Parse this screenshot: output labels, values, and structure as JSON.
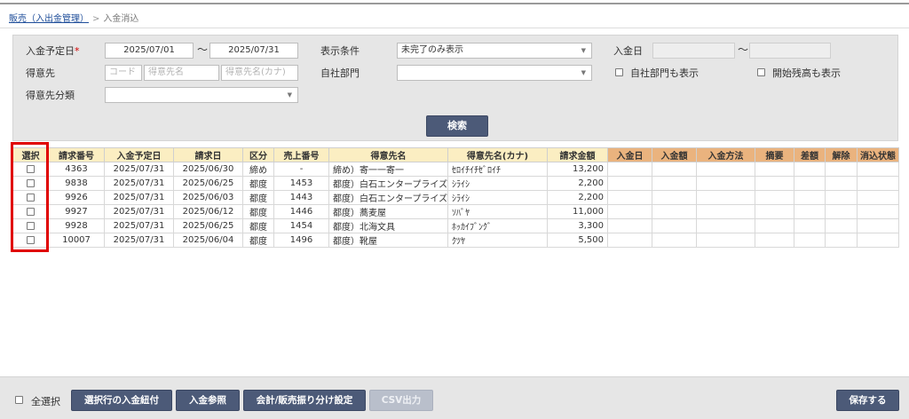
{
  "breadcrumb": {
    "parent": "販売（入出金管理）",
    "separator": ">",
    "current": "入金消込"
  },
  "search": {
    "due_date_label": "入金予定日",
    "required_mark": "*",
    "due_date_from": "2025/07/01",
    "range_sep": "〜",
    "due_date_to": "2025/07/31",
    "customer_label": "得意先",
    "customer_code_ph": "コード",
    "customer_name_ph": "得意先名",
    "customer_kana_ph": "得意先名(カナ)",
    "customer_class_label": "得意先分類",
    "customer_class_value": "",
    "display_label": "表示条件",
    "display_value": "未完了のみ表示",
    "dept_label": "自社部門",
    "dept_value": "",
    "payment_date_label": "入金日",
    "payment_date_from": "",
    "payment_date_to": "",
    "show_dept_label": "自社部門も表示",
    "show_opening_label": "開始残高も表示",
    "search_button": "検索"
  },
  "table": {
    "headers": [
      "選択",
      "請求番号",
      "入金予定日",
      "請求日",
      "区分",
      "売上番号",
      "得意先名",
      "得意先名(カナ)",
      "請求金額",
      "入金日",
      "入金額",
      "入金方法",
      "摘要",
      "差額",
      "解除",
      "消込状態"
    ],
    "rows": [
      {
        "invoice_no": "4363",
        "due_date": "2025/07/31",
        "invoice_date": "2025/06/30",
        "kind": "締め",
        "sales_no": "-",
        "customer": "締め）寄一一寄一",
        "kana": "ｾﾛｲﾁｲﾁｾﾞﾛｲﾁ",
        "amount": "13,200"
      },
      {
        "invoice_no": "9838",
        "due_date": "2025/07/31",
        "invoice_date": "2025/06/25",
        "kind": "都度",
        "sales_no": "1453",
        "customer": "都度）白石エンタープライズ",
        "kana": "ｼﾗｲｼ",
        "amount": "2,200"
      },
      {
        "invoice_no": "9926",
        "due_date": "2025/07/31",
        "invoice_date": "2025/06/03",
        "kind": "都度",
        "sales_no": "1443",
        "customer": "都度）白石エンタープライズ",
        "kana": "ｼﾗｲｼ",
        "amount": "2,200"
      },
      {
        "invoice_no": "9927",
        "due_date": "2025/07/31",
        "invoice_date": "2025/06/12",
        "kind": "都度",
        "sales_no": "1446",
        "customer": "都度）蕎麦屋",
        "kana": "ｿﾊﾞﾔ",
        "amount": "11,000"
      },
      {
        "invoice_no": "9928",
        "due_date": "2025/07/31",
        "invoice_date": "2025/06/25",
        "kind": "都度",
        "sales_no": "1454",
        "customer": "都度）北海文具",
        "kana": "ﾎｯｶｲﾌﾞﾝｸﾞ",
        "amount": "3,300"
      },
      {
        "invoice_no": "10007",
        "due_date": "2025/07/31",
        "invoice_date": "2025/06/04",
        "kind": "都度",
        "sales_no": "1496",
        "customer": "都度）靴屋",
        "kana": "ｸﾂﾔ",
        "amount": "5,500"
      }
    ]
  },
  "footer": {
    "select_all_label": "全選択",
    "apply_payment_button": "選択行の入金紐付",
    "payment_ref_button": "入金参照",
    "accounting_button": "会計/販売振り分け設定",
    "csv_button": "CSV出力",
    "save_button": "保存する"
  }
}
